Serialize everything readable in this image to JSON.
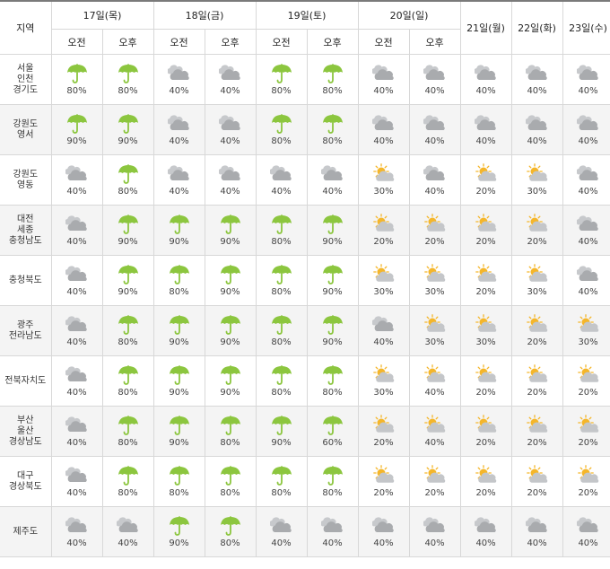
{
  "header": {
    "region_label": "지역",
    "am_label": "오전",
    "pm_label": "오후",
    "split_days": [
      "17일(목)",
      "18일(금)",
      "19일(토)",
      "20일(일)"
    ],
    "single_days": [
      "21일(월)",
      "22일(화)",
      "23일(수)"
    ]
  },
  "icons": {
    "rain": "umbrella-rain-icon",
    "cloudy": "cloudy-icon",
    "partly": "partly-cloudy-icon"
  },
  "colors": {
    "umbrella": "#8cc63f",
    "sun": "#f5b62a",
    "cloud": "#a9abae",
    "row_alt": "#f4f4f4"
  },
  "rows": [
    {
      "region": [
        "서울",
        "인천",
        "경기도"
      ],
      "cells": [
        [
          "rain",
          "80%"
        ],
        [
          "rain",
          "80%"
        ],
        [
          "cloudy",
          "40%"
        ],
        [
          "cloudy",
          "40%"
        ],
        [
          "rain",
          "80%"
        ],
        [
          "rain",
          "80%"
        ],
        [
          "cloudy",
          "40%"
        ],
        [
          "cloudy",
          "40%"
        ],
        [
          "cloudy",
          "40%"
        ],
        [
          "cloudy",
          "40%"
        ],
        [
          "cloudy",
          "40%"
        ]
      ]
    },
    {
      "region": [
        "강원도",
        "영서"
      ],
      "cells": [
        [
          "rain",
          "90%"
        ],
        [
          "rain",
          "90%"
        ],
        [
          "cloudy",
          "40%"
        ],
        [
          "cloudy",
          "40%"
        ],
        [
          "rain",
          "80%"
        ],
        [
          "rain",
          "80%"
        ],
        [
          "cloudy",
          "40%"
        ],
        [
          "cloudy",
          "40%"
        ],
        [
          "cloudy",
          "40%"
        ],
        [
          "cloudy",
          "40%"
        ],
        [
          "cloudy",
          "40%"
        ]
      ]
    },
    {
      "region": [
        "강원도",
        "영동"
      ],
      "cells": [
        [
          "cloudy",
          "40%"
        ],
        [
          "rain",
          "80%"
        ],
        [
          "cloudy",
          "40%"
        ],
        [
          "cloudy",
          "40%"
        ],
        [
          "cloudy",
          "40%"
        ],
        [
          "cloudy",
          "40%"
        ],
        [
          "partly",
          "30%"
        ],
        [
          "cloudy",
          "40%"
        ],
        [
          "partly",
          "20%"
        ],
        [
          "partly",
          "30%"
        ],
        [
          "cloudy",
          "40%"
        ]
      ]
    },
    {
      "region": [
        "대전",
        "세종",
        "충청남도"
      ],
      "cells": [
        [
          "cloudy",
          "40%"
        ],
        [
          "rain",
          "90%"
        ],
        [
          "rain",
          "90%"
        ],
        [
          "rain",
          "90%"
        ],
        [
          "rain",
          "80%"
        ],
        [
          "rain",
          "90%"
        ],
        [
          "partly",
          "20%"
        ],
        [
          "partly",
          "20%"
        ],
        [
          "partly",
          "20%"
        ],
        [
          "partly",
          "20%"
        ],
        [
          "cloudy",
          "40%"
        ]
      ]
    },
    {
      "region": [
        "충청북도"
      ],
      "cells": [
        [
          "cloudy",
          "40%"
        ],
        [
          "rain",
          "90%"
        ],
        [
          "rain",
          "80%"
        ],
        [
          "rain",
          "90%"
        ],
        [
          "rain",
          "80%"
        ],
        [
          "rain",
          "90%"
        ],
        [
          "partly",
          "30%"
        ],
        [
          "partly",
          "30%"
        ],
        [
          "partly",
          "20%"
        ],
        [
          "partly",
          "30%"
        ],
        [
          "cloudy",
          "40%"
        ]
      ]
    },
    {
      "region": [
        "광주",
        "전라남도"
      ],
      "cells": [
        [
          "cloudy",
          "40%"
        ],
        [
          "rain",
          "80%"
        ],
        [
          "rain",
          "90%"
        ],
        [
          "rain",
          "90%"
        ],
        [
          "rain",
          "80%"
        ],
        [
          "rain",
          "90%"
        ],
        [
          "cloudy",
          "40%"
        ],
        [
          "partly",
          "30%"
        ],
        [
          "partly",
          "30%"
        ],
        [
          "partly",
          "20%"
        ],
        [
          "partly",
          "30%"
        ]
      ]
    },
    {
      "region": [
        "전북자치도"
      ],
      "cells": [
        [
          "cloudy",
          "40%"
        ],
        [
          "rain",
          "80%"
        ],
        [
          "rain",
          "90%"
        ],
        [
          "rain",
          "90%"
        ],
        [
          "rain",
          "80%"
        ],
        [
          "rain",
          "80%"
        ],
        [
          "partly",
          "30%"
        ],
        [
          "partly",
          "40%"
        ],
        [
          "partly",
          "20%"
        ],
        [
          "partly",
          "20%"
        ],
        [
          "partly",
          "20%"
        ]
      ]
    },
    {
      "region": [
        "부산",
        "울산",
        "경상남도"
      ],
      "cells": [
        [
          "cloudy",
          "40%"
        ],
        [
          "rain",
          "80%"
        ],
        [
          "rain",
          "90%"
        ],
        [
          "rain",
          "80%"
        ],
        [
          "rain",
          "90%"
        ],
        [
          "rain",
          "60%"
        ],
        [
          "partly",
          "20%"
        ],
        [
          "partly",
          "40%"
        ],
        [
          "partly",
          "20%"
        ],
        [
          "partly",
          "20%"
        ],
        [
          "partly",
          "20%"
        ]
      ]
    },
    {
      "region": [
        "대구",
        "경상북도"
      ],
      "cells": [
        [
          "cloudy",
          "40%"
        ],
        [
          "rain",
          "80%"
        ],
        [
          "rain",
          "80%"
        ],
        [
          "rain",
          "80%"
        ],
        [
          "rain",
          "80%"
        ],
        [
          "rain",
          "80%"
        ],
        [
          "partly",
          "20%"
        ],
        [
          "partly",
          "20%"
        ],
        [
          "partly",
          "20%"
        ],
        [
          "partly",
          "20%"
        ],
        [
          "partly",
          "20%"
        ]
      ]
    },
    {
      "region": [
        "제주도"
      ],
      "cells": [
        [
          "cloudy",
          "40%"
        ],
        [
          "cloudy",
          "40%"
        ],
        [
          "rain",
          "90%"
        ],
        [
          "rain",
          "80%"
        ],
        [
          "cloudy",
          "40%"
        ],
        [
          "cloudy",
          "40%"
        ],
        [
          "cloudy",
          "40%"
        ],
        [
          "cloudy",
          "40%"
        ],
        [
          "cloudy",
          "40%"
        ],
        [
          "cloudy",
          "40%"
        ],
        [
          "cloudy",
          "40%"
        ]
      ]
    }
  ]
}
